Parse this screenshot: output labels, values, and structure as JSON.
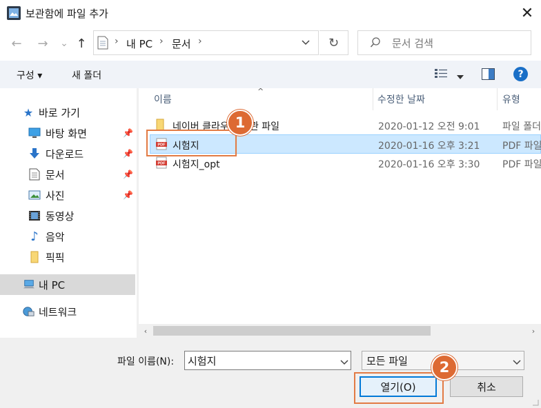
{
  "window": {
    "title": "보관함에 파일 추가",
    "close_glyph": "✕"
  },
  "nav": {
    "back_glyph": "←",
    "forward_glyph": "→",
    "recent_glyph": "⌄",
    "up_glyph": "↑",
    "breadcrumb": [
      "내 PC",
      "문서"
    ],
    "separator": "›",
    "refresh_glyph": "↻",
    "search_placeholder": "문서 검색"
  },
  "toolbar": {
    "organize_label": "구성 ▾",
    "new_folder_label": "새 폴더",
    "help_label": "?"
  },
  "sidebar": {
    "items": [
      {
        "label": "바로 가기",
        "icon": "star-icon",
        "pinned": false
      },
      {
        "label": "바탕 화면",
        "icon": "desktop-icon",
        "pinned": true
      },
      {
        "label": "다운로드",
        "icon": "download-icon",
        "pinned": true
      },
      {
        "label": "문서",
        "icon": "document-icon",
        "pinned": true
      },
      {
        "label": "사진",
        "icon": "picture-icon",
        "pinned": true
      },
      {
        "label": "동영상",
        "icon": "video-icon",
        "pinned": false
      },
      {
        "label": "음악",
        "icon": "music-icon",
        "pinned": false
      },
      {
        "label": "픽픽",
        "icon": "folder-icon",
        "pinned": false
      },
      {
        "label": "내 PC",
        "icon": "computer-icon",
        "pinned": false
      },
      {
        "label": "네트워크",
        "icon": "network-icon",
        "pinned": false
      }
    ]
  },
  "file_list": {
    "columns": [
      "이름",
      "수정한 날짜",
      "유형"
    ],
    "rows": [
      {
        "name": "네이버 클라우드 보관 파일",
        "date": "2020-01-12 오전 9:01",
        "type": "파일 폴더",
        "icon": "folder-icon"
      },
      {
        "name": "시험지",
        "date": "2020-01-16 오후 3:21",
        "type": "PDF 파일",
        "icon": "pdf-icon"
      },
      {
        "name": "시험지_opt",
        "date": "2020-01-16 오후 3:30",
        "type": "PDF 파일",
        "icon": "pdf-icon"
      }
    ],
    "selected_index": 1
  },
  "footer": {
    "filename_label": "파일 이름(N):",
    "filename_value": "시험지",
    "filter_value": "모든 파일",
    "open_label": "열기(O)",
    "cancel_label": "취소"
  },
  "annotations": {
    "step1": "1",
    "step2": "2"
  },
  "colors": {
    "accent": "#0078d7",
    "selection": "#cce8ff",
    "annotation": "#dd6a33",
    "pdf_red": "#d33c32",
    "folder_yellow": "#f8d775"
  }
}
